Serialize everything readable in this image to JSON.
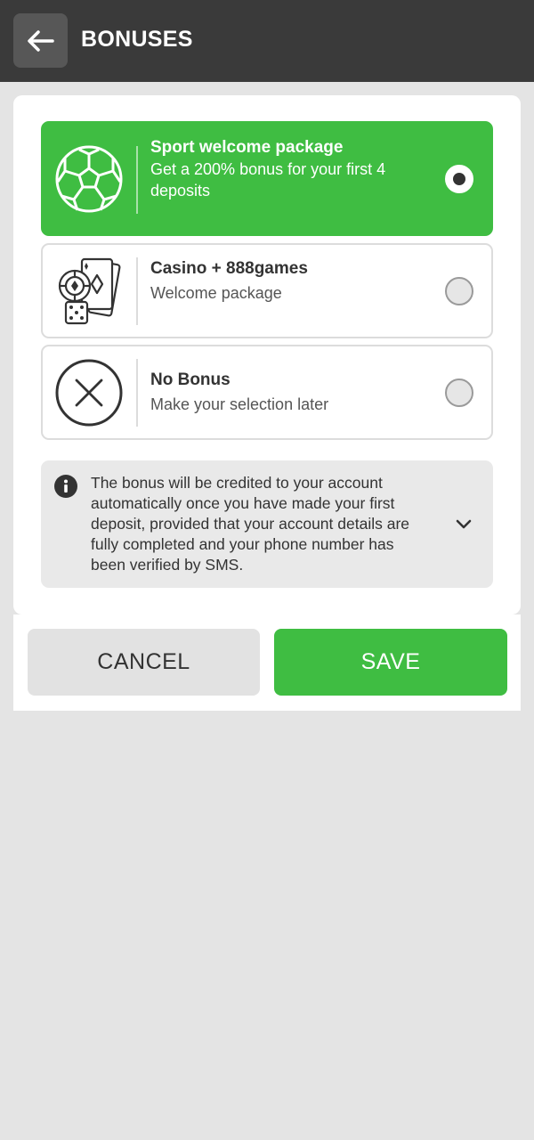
{
  "header": {
    "title": "BONUSES",
    "back_icon": "arrow-left-icon"
  },
  "options": [
    {
      "title": "Sport welcome package",
      "subtitle": "Get a 200% bonus for your first 4 deposits",
      "icon": "soccer-ball-icon",
      "selected": true
    },
    {
      "title": "Casino + 888games",
      "subtitle": "Welcome package",
      "icon": "casino-icon",
      "selected": false
    },
    {
      "title": "No Bonus",
      "subtitle": "Make your selection later",
      "icon": "no-bonus-icon",
      "selected": false
    }
  ],
  "info": {
    "text": "The bonus will be credited to your account automatically once you have made your first deposit, provided that your account details are fully completed and your phone number has been verified by SMS.",
    "icon": "info-icon",
    "toggle_icon": "chevron-down-icon"
  },
  "buttons": {
    "cancel": "CANCEL",
    "save": "SAVE"
  },
  "colors": {
    "header_bg": "#3a3a3a",
    "accent_green": "#3fbd42",
    "page_bg": "#e4e4e4"
  }
}
